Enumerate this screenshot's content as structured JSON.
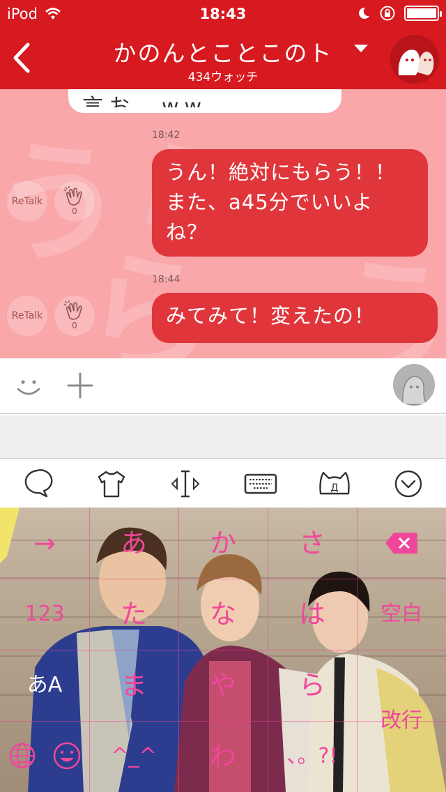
{
  "status_bar": {
    "carrier": "iPod",
    "time": "18:43"
  },
  "nav": {
    "title": "かのんとことこのト",
    "subtitle": "434ウォッチ"
  },
  "chat": {
    "previous_message_fragment": "言お　ww",
    "messages": [
      {
        "timestamp": "18:42",
        "text_lines": [
          "うん！絶対にもらう！！",
          "また、a45分でいいよ",
          "ね？"
        ],
        "retalk_label": "ReTalk",
        "clap_count": "0"
      },
      {
        "timestamp": "18:44",
        "text_lines": [
          "みてみて！変えたの！"
        ],
        "retalk_label": "ReTalk",
        "clap_count": "0"
      }
    ]
  },
  "input_bar": {
    "left_icons": [
      "smiley-icon",
      "plus-icon"
    ],
    "right_icon": "avatar-placeholder-icon"
  },
  "keyboard_toolbar": {
    "icons": [
      "chat-bubble-icon",
      "shirt-icon",
      "cursor-icon",
      "keyboard-icon",
      "kaomoji-cat-icon",
      "collapse-icon"
    ]
  },
  "keyboard": {
    "accent_color": "#f0479b",
    "rows": [
      [
        "→",
        "あ",
        "か",
        "さ",
        "⌫"
      ],
      [
        "123",
        "た",
        "な",
        "は",
        "空白"
      ],
      [
        "あA",
        "ま",
        "や",
        "ら",
        "改行"
      ],
      [
        "🌐",
        "☺",
        "^_^",
        "わ",
        "、。?!"
      ]
    ]
  }
}
